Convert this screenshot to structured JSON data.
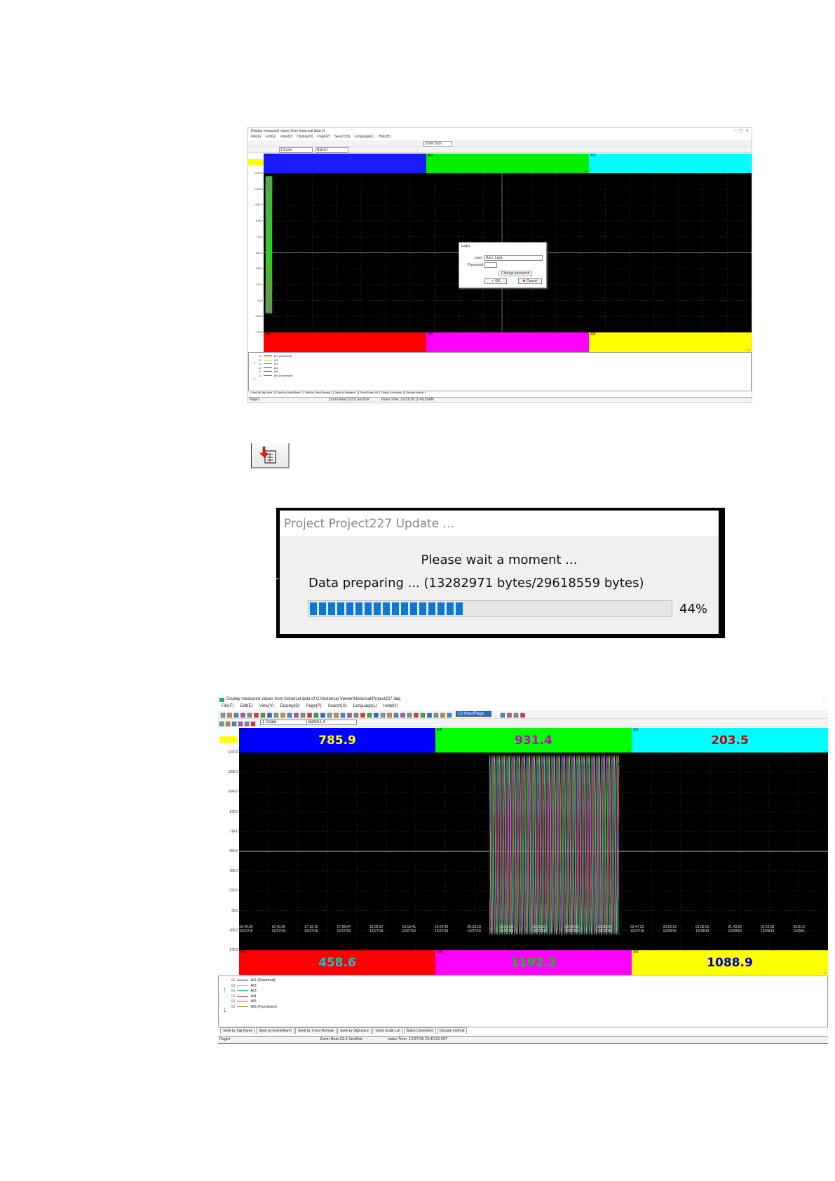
{
  "screen1": {
    "title": "Display measured values from historical data of",
    "menus": [
      "File(F)",
      "Edit(E)",
      "View(V)",
      "Display(D)",
      "Page(P)",
      "Search(S)",
      "Language(L)",
      "Help(H)"
    ],
    "zoom_select": "Zoom Size",
    "scale_select": "1 Scale",
    "batch_select": "Batch1",
    "top_tags": [
      "AI1",
      "AI2",
      "AI3"
    ],
    "bottom_tags": [
      "AI4",
      "AI5",
      "AI6"
    ],
    "top_colors": [
      "#1a1aff",
      "#00ee00",
      "#00ffff"
    ],
    "bottom_colors": [
      "#ff0000",
      "#ff00ff",
      "#ffff00"
    ],
    "y_labels": [
      "1370.0",
      "1206.0",
      "1042.0",
      "878.0",
      "714.0",
      "550.0",
      "386.0",
      "222.0",
      "58.0",
      "-106.0",
      "-270.0"
    ],
    "login": {
      "title": "Login",
      "user_label": "User:",
      "user_value": "Raw_Lab1",
      "password_label": "Password:",
      "change_password": "Change password",
      "ok": "OK",
      "cancel": "Cancel"
    },
    "legend": [
      "AI1 (Rawmod)",
      "AI2",
      "AI3",
      "AI4",
      "AI5",
      "AI6 (Formfront)"
    ],
    "tabs": [
      "Seek by Tag Name",
      "Seek by Event/Alarm",
      "Seek by Trend Remark",
      "Seek by Signature",
      "Trend Scale List",
      "Batch Comments",
      "Decade method"
    ],
    "status": {
      "page": "Page1",
      "zoom": "Zoom Rate:233.0 Sec/Dot",
      "index": "Index Time: 12/31/18 11:49:28AM"
    }
  },
  "icon": {
    "name": "export-data-icon"
  },
  "dialog": {
    "title": "Project Project227 Update ...",
    "message1": "Please wait a moment ...",
    "message2": "Data preparing ... (13282971 bytes/29618559 bytes)",
    "progress_pct": 44,
    "progress_text": "44%"
  },
  "screen2": {
    "title": "Display measured values from historical data of C:\\Historical Viewer\\Historical\\Project227.daq",
    "menus": [
      "File(F)",
      "Edit(E)",
      "View(V)",
      "Display(D)",
      "Page(P)",
      "Search(S)",
      "Language(L)",
      "Help(H)"
    ],
    "zoom_select": "12 Hour/Page",
    "scale_select": "1 Scale",
    "batch_select": "Batch1-4",
    "top": [
      {
        "tag": "AI1",
        "value": "785.9",
        "bg": "#0000ff",
        "fg": "#ffff00"
      },
      {
        "tag": "AI2",
        "value": "931.4",
        "bg": "#00ff00",
        "fg": "#cc00cc"
      },
      {
        "tag": "AI3",
        "value": "203.5",
        "bg": "#00ffff",
        "fg": "#cc0000"
      }
    ],
    "bottom": [
      {
        "tag": "AI4",
        "value": "458.6",
        "bg": "#ff0000",
        "fg": "#00cccc"
      },
      {
        "tag": "AI5",
        "value": "1192.2",
        "bg": "#ff00ff",
        "fg": "#00cc00"
      },
      {
        "tag": "AI6",
        "value": "1088.9",
        "bg": "#ffff00",
        "fg": "#0000cc"
      }
    ],
    "y_labels": [
      "1370.0",
      "1206.0",
      "1042.0",
      "878.0",
      "714.0",
      "550.0",
      "386.0",
      "222.0",
      "58.0",
      "-106.0",
      "-270.0"
    ],
    "x_labels": [
      [
        "15:49:36",
        "12/27/18"
      ],
      [
        "16:40:26",
        "12/27/18"
      ],
      [
        "17:19:15",
        "12/27/18"
      ],
      [
        "17:58:04",
        "12/27/18"
      ],
      [
        "18:36:52",
        "12/27/18"
      ],
      [
        "19:15:41",
        "12/27/18"
      ],
      [
        "19:54:29",
        "12/27/18"
      ],
      [
        "20:33:18",
        "12/27/18"
      ],
      [
        "21:12:06",
        "12/27/18"
      ],
      [
        "21:50:57",
        "12/27/18"
      ],
      [
        "22:29:43",
        "12/27/18"
      ],
      [
        "23:08:34",
        "12/27/18"
      ],
      [
        "23:47:23",
        "12/27/18"
      ],
      [
        "00:26:12",
        "12/28/18"
      ],
      [
        "01:05:01",
        "12/28/18"
      ],
      [
        "01:43:50",
        "12/28/18"
      ],
      [
        "02:22:39",
        "12/28/18"
      ],
      [
        "03:01:2",
        "12/28/1"
      ]
    ],
    "legend": [
      "AI1 (Rawmod)",
      "AI2",
      "AI3",
      "AI4",
      "AI5",
      "AI6 (Formfront)"
    ],
    "legend_colors": [
      "#0000ff",
      "#cccc00",
      "#00cccc",
      "#ff0000",
      "#ff00ff",
      "#888800"
    ],
    "tabs": [
      "Seek by Tag Name",
      "Seek by Event/Alarm",
      "Seek by Trend Remark",
      "Seek by Signature",
      "Trend Scale List",
      "Batch Comments",
      "Decade method"
    ],
    "status": {
      "page": "Page1",
      "zoom": "Zoom Rate:23.3 Sec/Dot",
      "index": "Index Time: 12/27/18 23:40:26:26T"
    }
  }
}
